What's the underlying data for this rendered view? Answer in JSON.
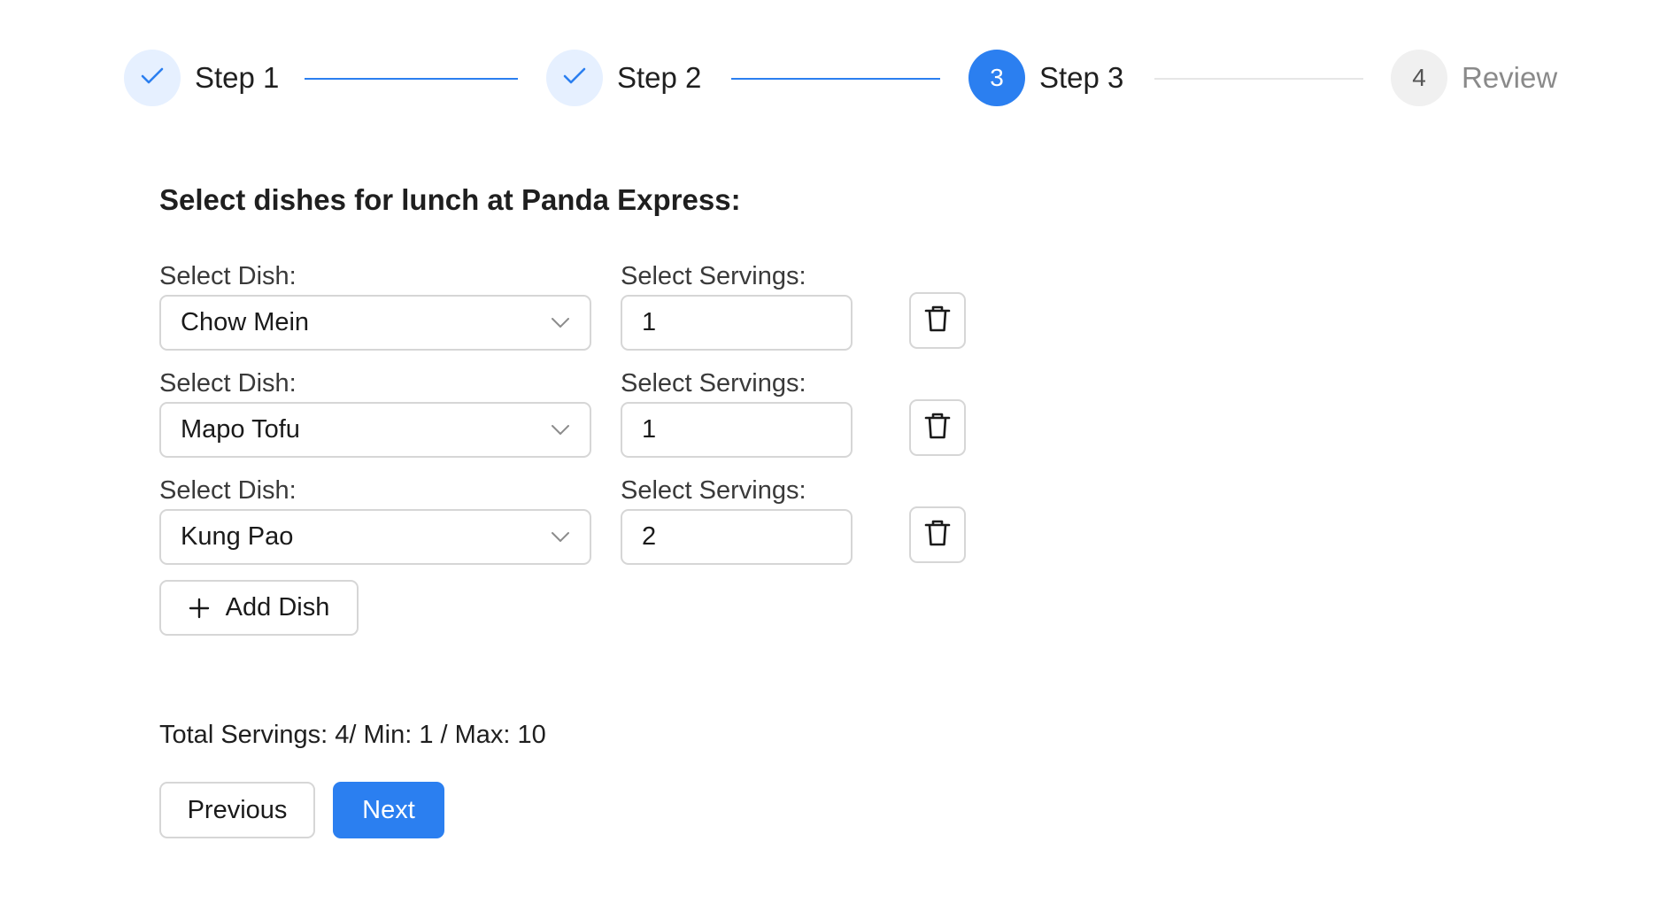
{
  "stepper": {
    "steps": [
      {
        "label": "Step 1",
        "number": "1",
        "state": "done"
      },
      {
        "label": "Step 2",
        "number": "2",
        "state": "done"
      },
      {
        "label": "Step 3",
        "number": "3",
        "state": "active"
      },
      {
        "label": "Review",
        "number": "4",
        "state": "pending"
      }
    ]
  },
  "form": {
    "title": "Select dishes for lunch at Panda Express:",
    "dish_label": "Select Dish:",
    "servings_label": "Select Servings:",
    "rows": [
      {
        "dish": "Chow Mein",
        "servings": "1"
      },
      {
        "dish": "Mapo Tofu",
        "servings": "1"
      },
      {
        "dish": "Kung Pao",
        "servings": "2"
      }
    ],
    "add_label": "Add Dish",
    "totals_text": "Total Servings: 4/ Min: 1 / Max: 10"
  },
  "nav": {
    "previous_label": "Previous",
    "next_label": "Next"
  },
  "colors": {
    "accent": "#2b7ff0",
    "done_bg": "#e6f0ff",
    "pending_bg": "#f0f0f0",
    "border": "#d6d6d6"
  },
  "icons": {
    "done": "check-icon",
    "select": "chevron-down-icon",
    "delete": "trash-icon",
    "add": "plus-icon"
  }
}
